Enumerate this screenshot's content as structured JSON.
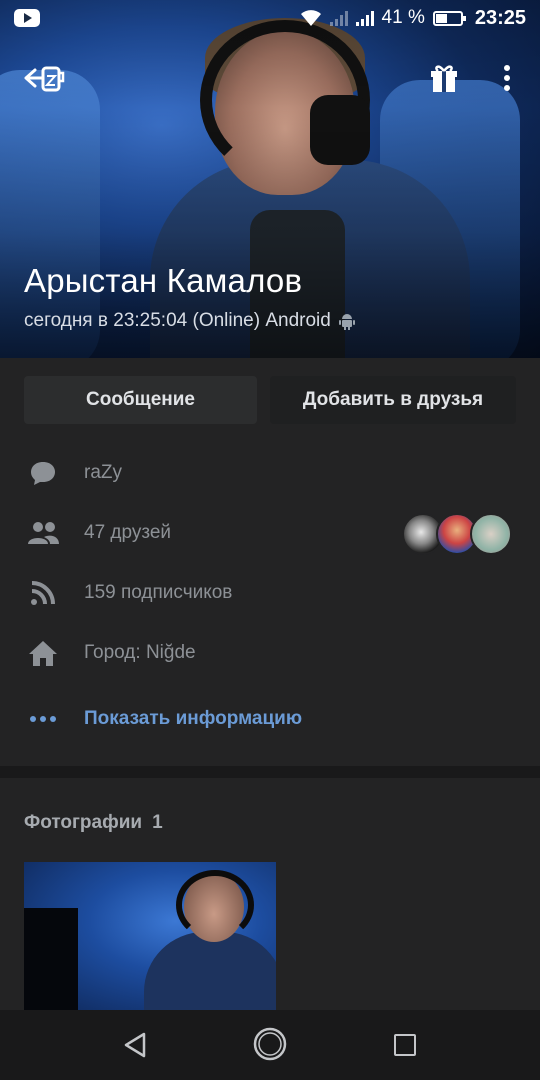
{
  "status_bar": {
    "battery": "41 %",
    "time": "23:25"
  },
  "profile": {
    "name": "Арыстан Камалов",
    "last_seen": "сегодня в 23:25:04 (Online) Android"
  },
  "actions": {
    "message_label": "Сообщение",
    "add_friend_label": "Добавить в друзья"
  },
  "info": {
    "status": "raZy",
    "friends": "47 друзей",
    "followers": "159 подписчиков",
    "city": "Город: Niğde",
    "show_info": "Показать информацию"
  },
  "photos": {
    "title": "Фотографии",
    "count": "1"
  },
  "colors": {
    "background": "#19191a",
    "card": "#232324",
    "link": "#6b9bd6",
    "muted": "#8d9196"
  }
}
